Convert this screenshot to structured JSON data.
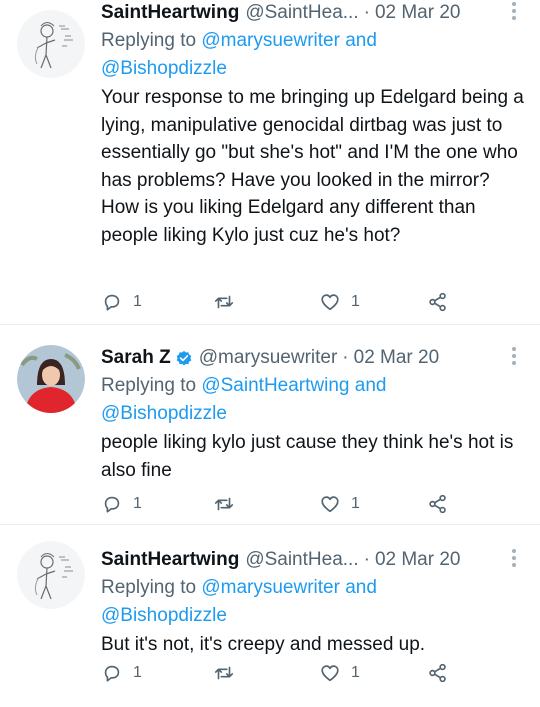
{
  "tweets": [
    {
      "name": "SaintHeartwing",
      "handle": "@SaintHea...",
      "dot": "·",
      "date": "02 Mar 20",
      "verified": false,
      "replying_prefix": "Replying to ",
      "mention1": "@marysuewriter",
      "mention_join": " and",
      "mention2": "@Bishopdizzle",
      "text": "Your response to me bringing up Edelgard being a lying, manipulative genocidal dirtbag was just to essentially go \"but she's hot\" and I'M the one who has problems? Have you looked in the mirror? How is you liking Edelgard any different than people liking Kylo just cuz he's hot?",
      "reply_count": "1",
      "like_count": "1"
    },
    {
      "name": "Sarah Z",
      "handle": "@marysuewriter",
      "dot": "·",
      "date": "02 Mar 20",
      "verified": true,
      "replying_prefix": "Replying to ",
      "mention1": "@SaintHeartwing",
      "mention_join": " and",
      "mention2": "@Bishopdizzle",
      "text": "people liking kylo just cause they think he's hot is also fine",
      "reply_count": "1",
      "like_count": "1"
    },
    {
      "name": "SaintHeartwing",
      "handle": "@SaintHea...",
      "dot": "·",
      "date": "02 Mar 20",
      "verified": false,
      "replying_prefix": "Replying to ",
      "mention1": "@marysuewriter",
      "mention_join": " and",
      "mention2": "@Bishopdizzle",
      "text": "But it's not, it's creepy and messed up.",
      "reply_count": "1",
      "like_count": "1"
    }
  ],
  "icons": {
    "reply": "reply-icon",
    "retweet": "retweet-icon",
    "like": "heart-icon",
    "share": "share-icon",
    "more": "more-options-icon",
    "verified": "verified-badge-icon"
  },
  "colors": {
    "text": "#0f1419",
    "secondary": "#536471",
    "link": "#1d9bf0",
    "divider": "#e6ecf0",
    "sarah_avatar_bg": "#b3c6d6",
    "sarah_sweater": "#e0252c"
  }
}
